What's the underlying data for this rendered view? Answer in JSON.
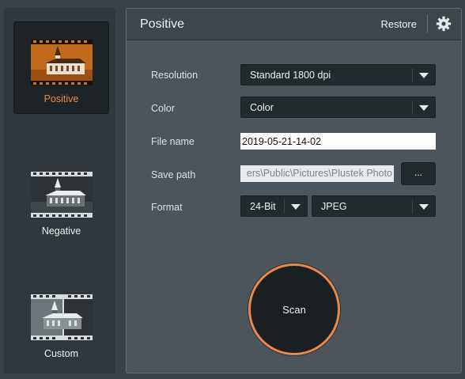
{
  "sidebar": {
    "modes": [
      {
        "label": "Positive",
        "icon": "church-positive-film-icon",
        "active": true
      },
      {
        "label": "Negative",
        "icon": "church-negative-film-icon",
        "active": false
      },
      {
        "label": "Custom",
        "icon": "church-custom-film-icon",
        "active": false
      }
    ]
  },
  "header": {
    "title": "Positive",
    "restore_label": "Restore",
    "settings_icon": "gear-icon"
  },
  "form": {
    "resolution": {
      "label": "Resolution",
      "value": "Standard 1800 dpi"
    },
    "color": {
      "label": "Color",
      "value": "Color"
    },
    "file_name": {
      "label": "File name",
      "value": "2019-05-21-14-02"
    },
    "save_path": {
      "label": "Save path",
      "value": "ers\\Public\\Pictures\\Plustek Photo",
      "browse_label": "..."
    },
    "format": {
      "label": "Format",
      "bit_depth": "24-Bit",
      "file_type": "JPEG"
    }
  },
  "scan_label": "Scan",
  "colors": {
    "accent": "#f0873a",
    "scan_ring": "#e8884a",
    "panel": "#4b555b",
    "background": "#3a4247"
  }
}
